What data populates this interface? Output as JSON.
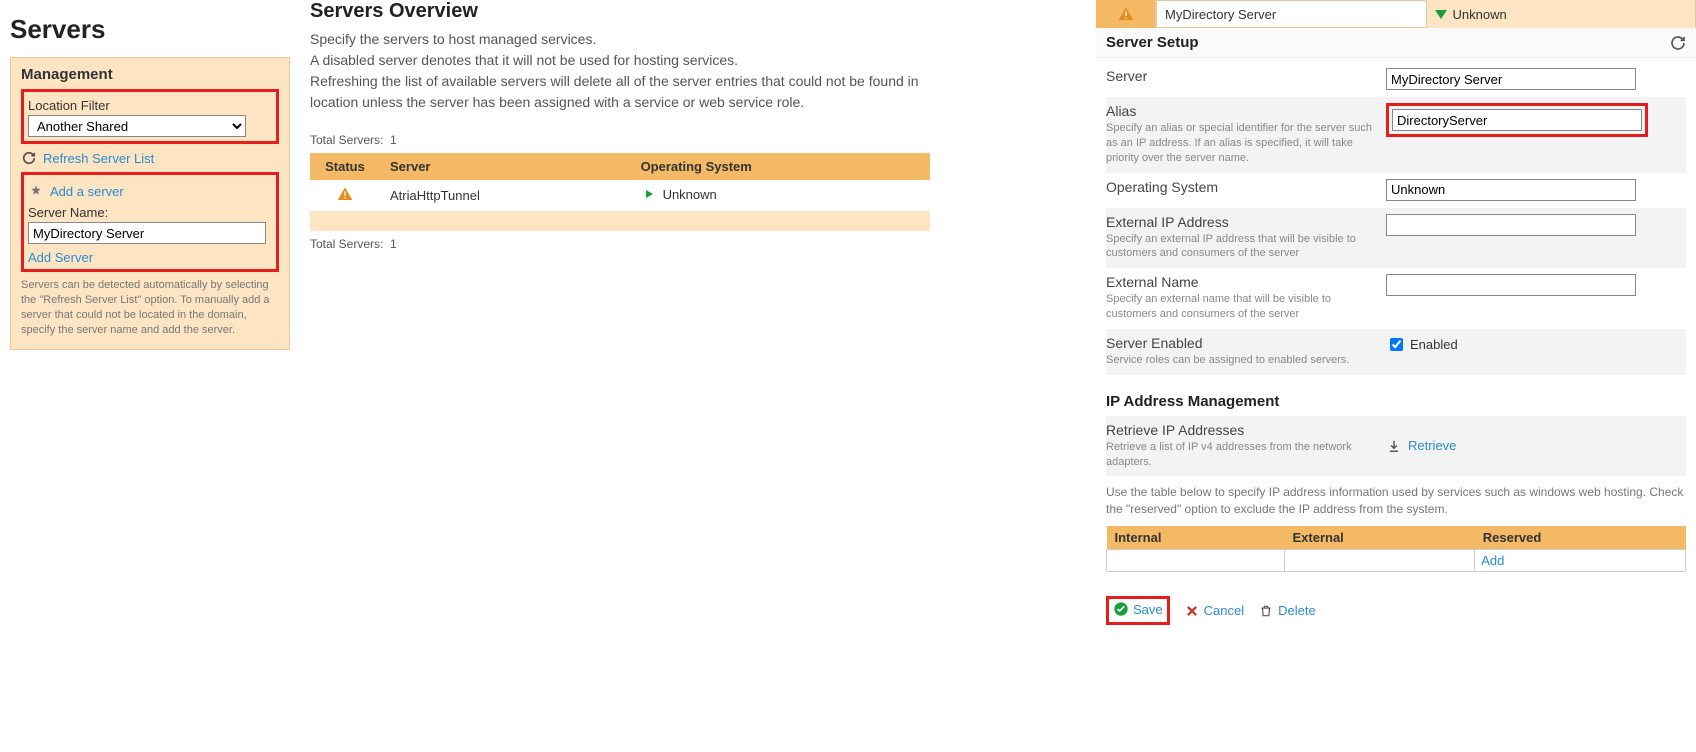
{
  "left": {
    "page_title": "Servers",
    "panel_title": "Management",
    "location_filter_label": "Location Filter",
    "location_filter_value": "Another Shared",
    "refresh_link": "Refresh Server List",
    "add_server_heading": "Add a server",
    "server_name_label": "Server Name:",
    "server_name_value": "MyDirectory Server",
    "add_server_link": "Add Server",
    "hint": "Servers can be detected automatically by selecting the \"Refresh Server List\" option. To manually add a server that could not be located in the domain, specify the server name and add the server."
  },
  "overview": {
    "title": "Servers Overview",
    "desc_line1": "Specify the servers to host managed services.",
    "desc_line2": "A disabled server denotes that it will not be used for hosting services.",
    "desc_line3": "Refreshing the list of available servers will delete all of the server entries that could not be found in location unless the server has been assigned with a service or web service role.",
    "total_label": "Total Servers:",
    "total_value": "1",
    "columns": {
      "status": "Status",
      "server": "Server",
      "os": "Operating System"
    },
    "rows": [
      {
        "server": "AtriaHttpTunnel",
        "os": "Unknown"
      }
    ]
  },
  "right": {
    "hdr_name": "MyDirectory Server",
    "hdr_os": "Unknown",
    "setup_title": "Server Setup",
    "fields": {
      "server": {
        "label": "Server",
        "value": "MyDirectory Server"
      },
      "alias": {
        "label": "Alias",
        "desc": "Specify an alias or special identifier for the server such as an IP address. If an alias is specified, it will take priority over the server name.",
        "value": "DirectoryServer"
      },
      "os": {
        "label": "Operating System",
        "value": "Unknown"
      },
      "ext_ip": {
        "label": "External IP Address",
        "desc": "Specify an external IP address that will be visible to customers and consumers of the server",
        "value": ""
      },
      "ext_name": {
        "label": "External Name",
        "desc": "Specify an external name that will be visible to customers and consumers of the server",
        "value": ""
      },
      "enabled": {
        "label": "Server Enabled",
        "desc": "Service roles can be assigned to enabled servers.",
        "check_label": "Enabled"
      }
    },
    "ipmgmt": {
      "title": "IP Address Management",
      "retrieve_label": "Retrieve IP Addresses",
      "retrieve_desc": "Retrieve a list of IP v4 addresses from the network adapters.",
      "retrieve_link": "Retrieve",
      "note": "Use the table below to specify IP address information used by services such as windows web hosting. Check the \"reserved\" option to exclude the IP address from the system.",
      "cols": {
        "internal": "Internal",
        "external": "External",
        "reserved": "Reserved"
      },
      "add_link": "Add"
    },
    "buttons": {
      "save": "Save",
      "cancel": "Cancel",
      "delete": "Delete"
    }
  }
}
